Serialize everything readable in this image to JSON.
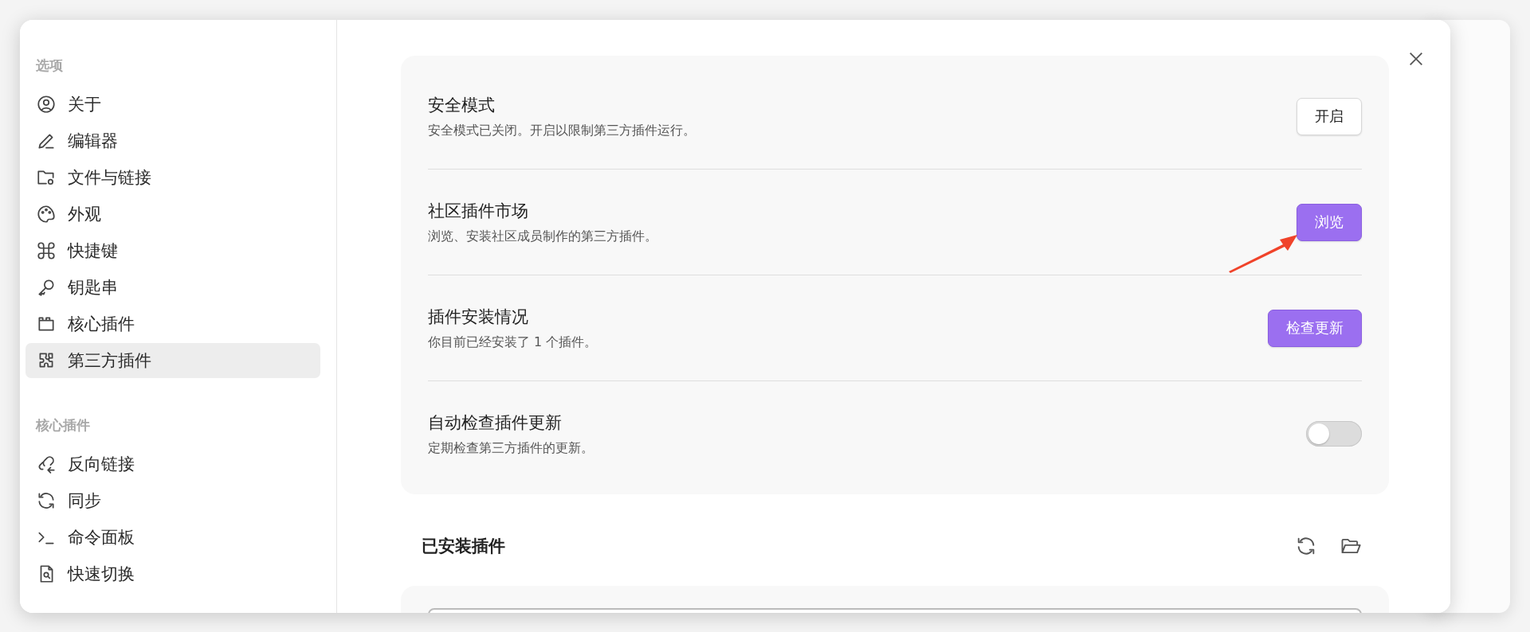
{
  "sidebar": {
    "sections": [
      {
        "heading": "选项",
        "items": [
          {
            "label": "关于",
            "selected": false
          },
          {
            "label": "编辑器",
            "selected": false
          },
          {
            "label": "文件与链接",
            "selected": false
          },
          {
            "label": "外观",
            "selected": false
          },
          {
            "label": "快捷键",
            "selected": false
          },
          {
            "label": "钥匙串",
            "selected": false
          },
          {
            "label": "核心插件",
            "selected": false
          },
          {
            "label": "第三方插件",
            "selected": true
          }
        ]
      },
      {
        "heading": "核心插件",
        "items": [
          {
            "label": "反向链接",
            "selected": false
          },
          {
            "label": "同步",
            "selected": false
          },
          {
            "label": "命令面板",
            "selected": false
          },
          {
            "label": "快速切换",
            "selected": false
          }
        ]
      }
    ]
  },
  "settings": [
    {
      "title": "安全模式",
      "description": "安全模式已关闭。开启以限制第三方插件运行。",
      "kind": "button",
      "button": {
        "label": "开启",
        "primary": false
      }
    },
    {
      "title": "社区插件市场",
      "description": "浏览、安装社区成员制作的第三方插件。",
      "kind": "button",
      "button": {
        "label": "浏览",
        "primary": true
      }
    },
    {
      "title": "插件安装情况",
      "description": "你目前已经安装了 1 个插件。",
      "kind": "button",
      "button": {
        "label": "检查更新",
        "primary": true
      }
    },
    {
      "title": "自动检查插件更新",
      "description": "定期检查第三方插件的更新。",
      "kind": "toggle",
      "on": false
    }
  ],
  "installed": {
    "title": "已安装插件"
  }
}
